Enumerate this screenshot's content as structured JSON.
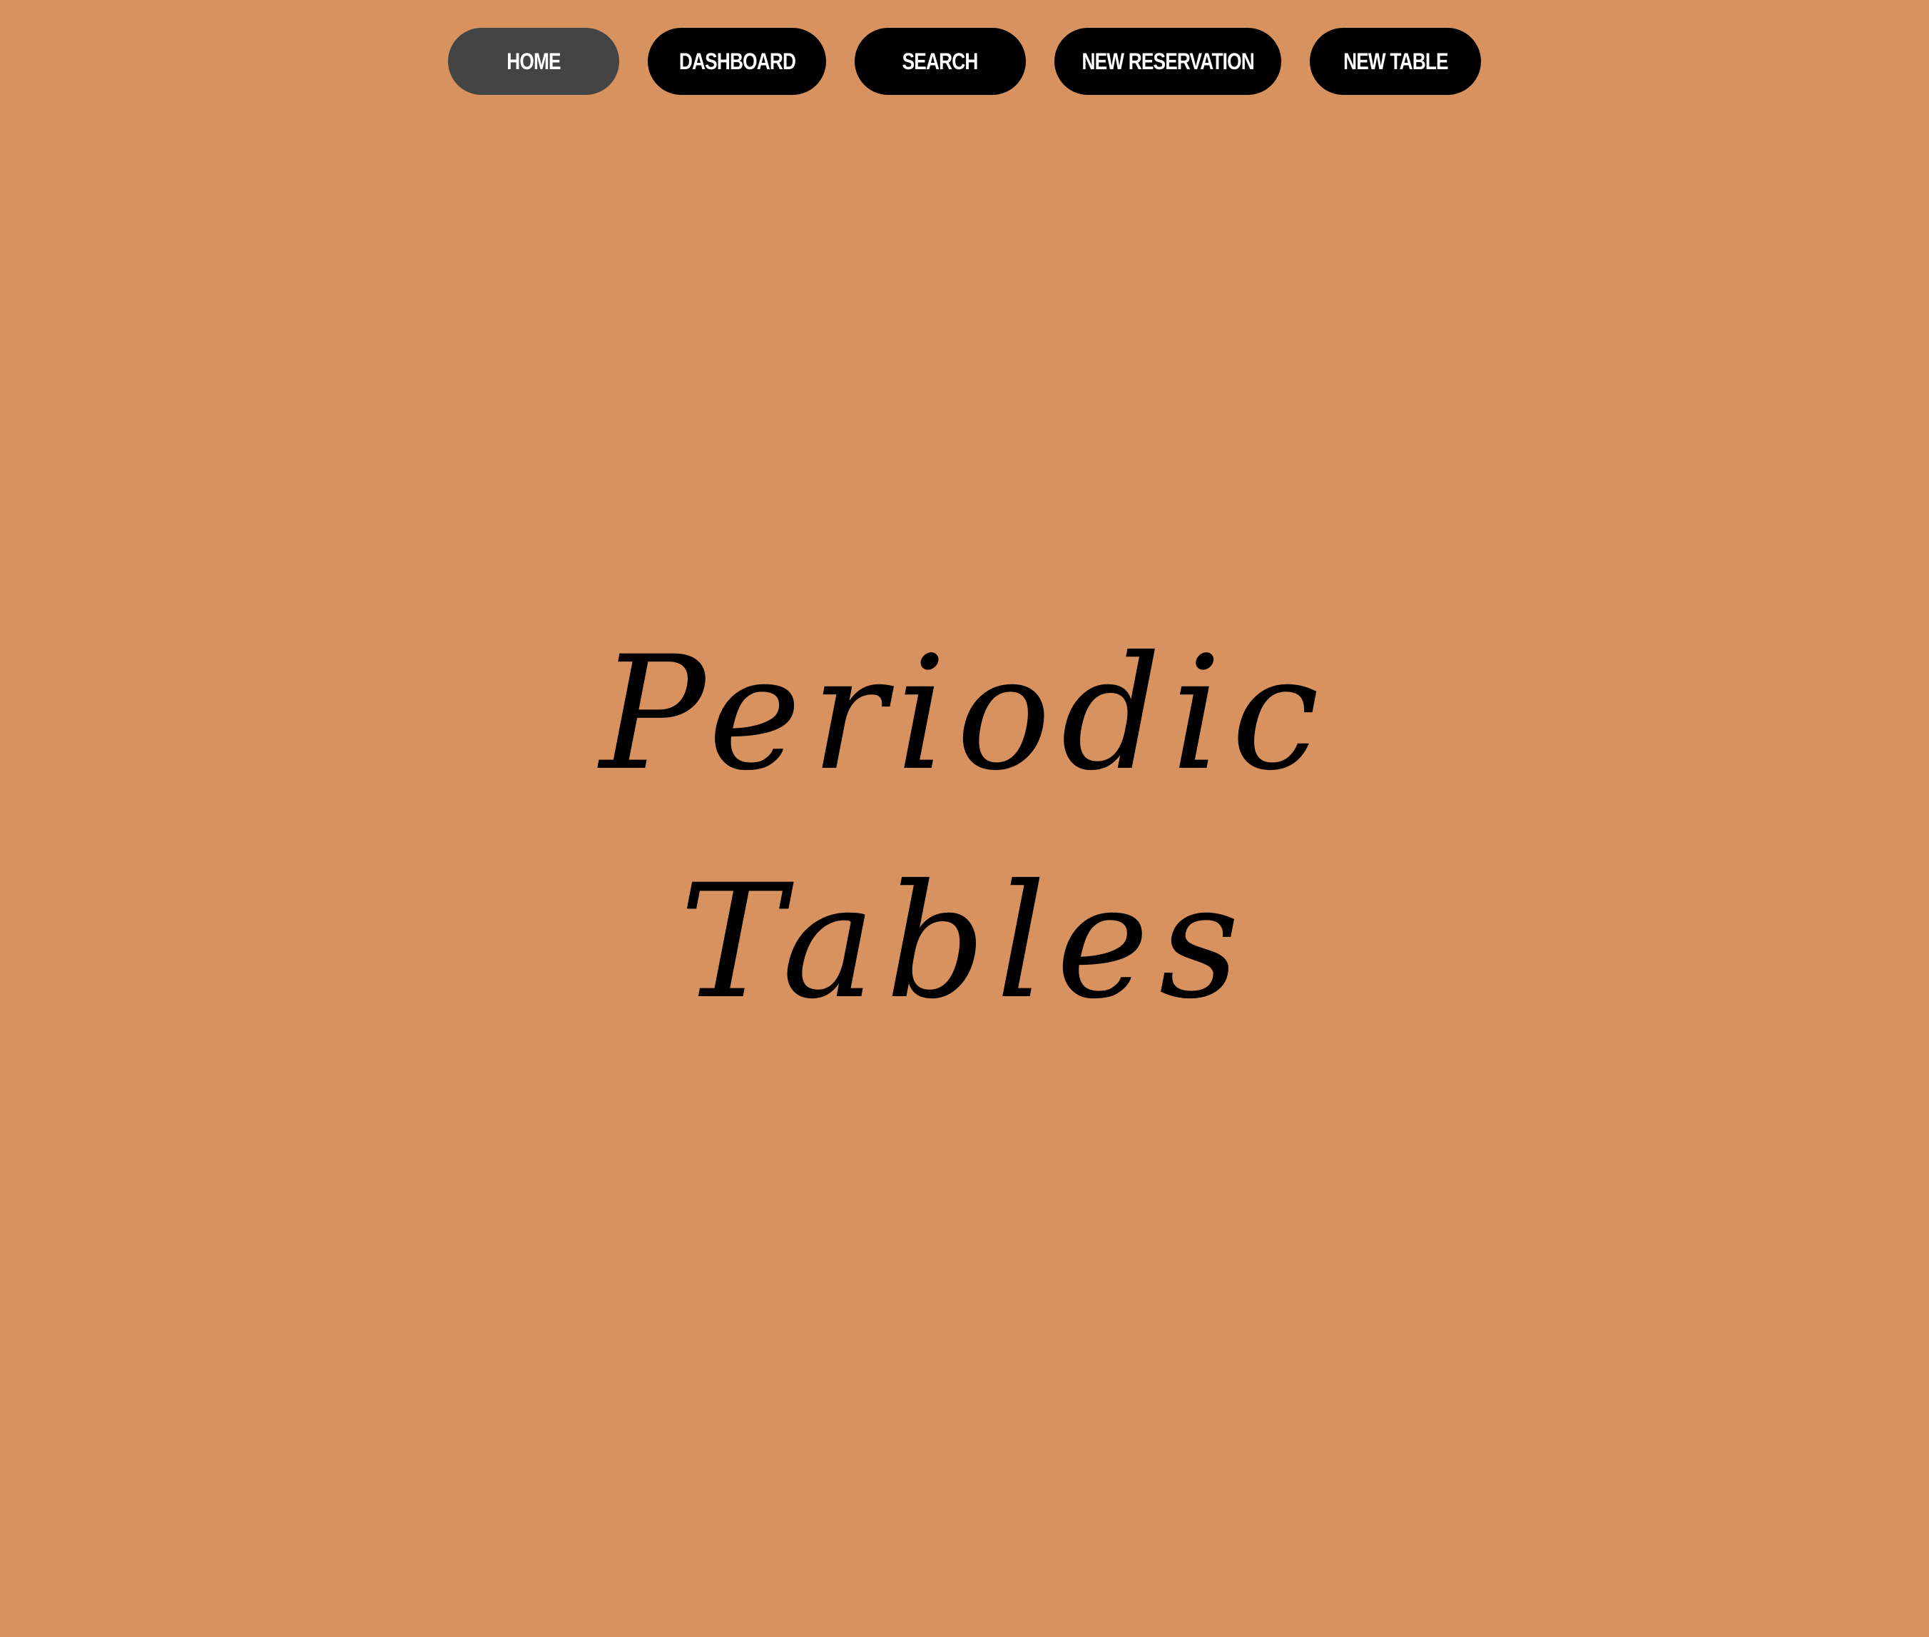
{
  "colors": {
    "background": "#D79260",
    "nav_active_bg": "#444444",
    "nav_bg": "#000000",
    "nav_text": "#FFFFFF",
    "hero_text": "#000000"
  },
  "nav": {
    "items": [
      {
        "label": "Home",
        "active": true
      },
      {
        "label": "Dashboard",
        "active": false
      },
      {
        "label": "Search",
        "active": false
      },
      {
        "label": "New Reservation",
        "active": false
      },
      {
        "label": "New Table",
        "active": false
      }
    ]
  },
  "hero": {
    "line1": "Periodic",
    "line2": "Tables"
  }
}
